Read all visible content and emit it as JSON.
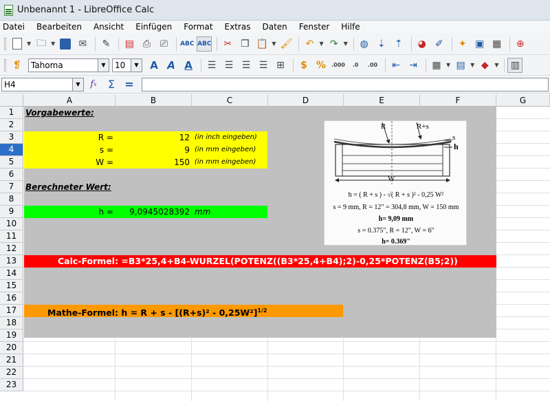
{
  "window": {
    "title": "Unbenannt 1 - LibreOffice Calc"
  },
  "menu": [
    "Datei",
    "Bearbeiten",
    "Ansicht",
    "Einfügen",
    "Format",
    "Extras",
    "Daten",
    "Fenster",
    "Hilfe"
  ],
  "format_bar": {
    "font_name": "Tahoma",
    "font_size": "10"
  },
  "formula_bar": {
    "name_box": "H4",
    "input_value": ""
  },
  "columns": [
    "A",
    "B",
    "C",
    "D",
    "E",
    "F",
    "G"
  ],
  "rows": [
    "1",
    "2",
    "3",
    "4",
    "5",
    "6",
    "7",
    "8",
    "9",
    "10",
    "11",
    "12",
    "13",
    "14",
    "15",
    "16",
    "17",
    "18",
    "19",
    "20",
    "21",
    "22",
    "23"
  ],
  "active_row": "4",
  "cells": {
    "a1": "Vorgabewerte:",
    "r_label": "R =",
    "r_value": "12",
    "r_hint": "(in inch eingeben)",
    "s_label": "s =",
    "s_value": "9",
    "s_hint": "(in mm eingeben)",
    "w_label": "W =",
    "w_value": "150",
    "w_hint": "(in mm eingeben)",
    "a7": "Berechneter Wert:",
    "h_label": "h =",
    "h_value": "9,0945028392",
    "h_unit": "mm",
    "calc_formula": "Calc-Formel:  =B3*25,4+B4-WURZEL(POTENZ((B3*25,4+B4);2)-0,25*POTENZ(B5;2))",
    "math_formula": "Mathe-Formel:  h = R + s - [(R+s)² - 0,25W²]",
    "math_formula_exp": "1/2"
  },
  "diagram": {
    "label_r": "R",
    "label_rs": "R+s",
    "label_s": "s",
    "label_h": "h",
    "label_w": "W",
    "formula": "h = ( R + s ) - √( R + s )² - 0,25 W²",
    "line_metric": "s = 9 mm, R = 12\" = 304,8 mm, W = 150 mm",
    "result_metric": "h= 9,09  mm",
    "line_imperial": "s = 0.375\", R = 12\", W = 6\"",
    "result_imperial": "h= 0.369\""
  },
  "colors": {
    "yellow": "#ffff00",
    "green": "#00ff00",
    "red": "#ff0000",
    "orange": "#ff9900",
    "gray": "#c0c0c0",
    "active_row": "#2d6fc7"
  }
}
